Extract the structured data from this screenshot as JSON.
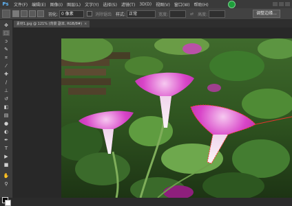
{
  "menu": {
    "logo": "Ps",
    "items": [
      "文件(F)",
      "编辑(E)",
      "图像(I)",
      "图层(L)",
      "文字(Y)",
      "选择(S)",
      "滤镜(T)",
      "3D(D)",
      "视图(V)",
      "窗口(W)",
      "帮助(H)"
    ]
  },
  "options": {
    "feather_label": "羽化:",
    "feather_value": "0 像素",
    "antialias_label": "消除锯齿",
    "style_label": "样式:",
    "style_value": "正常",
    "width_label": "宽度:",
    "height_label": "高度:",
    "refine_edge": "调整边缘..."
  },
  "document": {
    "tab_title": "素材1.jpg @ 121% (背景 副本, RGB/8#)",
    "tab_close": "×"
  },
  "toolbar": {
    "tools": [
      "move",
      "marquee",
      "lasso",
      "quick-selection",
      "crop",
      "eyedropper",
      "healing",
      "brush",
      "clone-stamp",
      "history-brush",
      "eraser",
      "gradient",
      "blur",
      "dodge",
      "pen",
      "type",
      "path-selection",
      "shape",
      "hand",
      "zoom"
    ],
    "glyphs": [
      "✥",
      "⬚",
      "ↄ",
      "✎",
      "⌗",
      "⁄",
      "✚",
      "∕",
      "⊥",
      "↺",
      "◧",
      "▤",
      "●",
      "◐",
      "✒",
      "T",
      "▶",
      "■",
      "✋",
      "⚲"
    ]
  },
  "colors": {
    "accent_green": "#1e9e3b",
    "selection_red": "#e8322e",
    "flower_magenta": "#d640c8"
  }
}
